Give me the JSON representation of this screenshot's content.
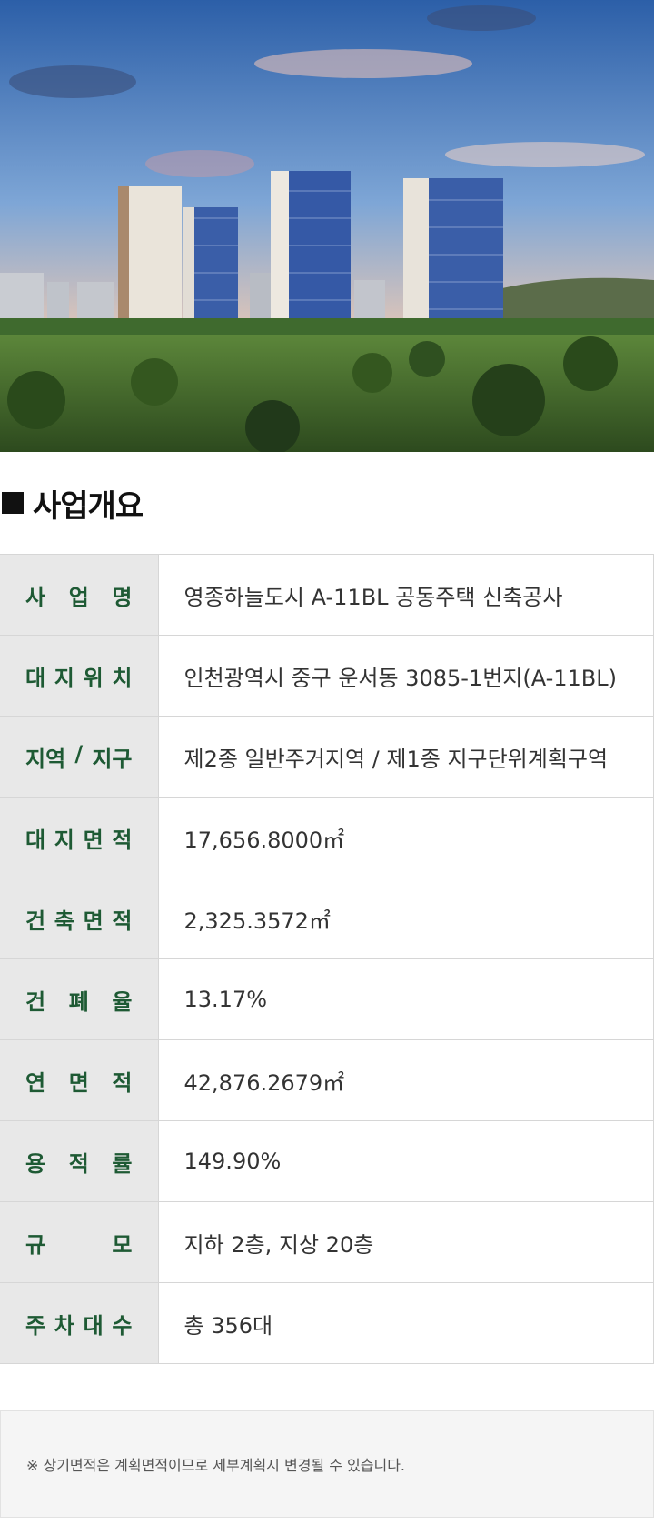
{
  "hero": {
    "image": "apartment-complex-rendering"
  },
  "section": {
    "title": "사업개요"
  },
  "rows": [
    {
      "label": [
        "사",
        "업",
        "명"
      ],
      "value": "영종하늘도시 A-11BL  공동주택 신축공사"
    },
    {
      "label": [
        "대",
        "지",
        "위",
        "치"
      ],
      "value": "인천광역시 중구 운서동 3085-1번지(A-11BL)"
    },
    {
      "label": [
        "지역",
        "/",
        "지구"
      ],
      "value": "제2종 일반주거지역 / 제1종 지구단위계획구역"
    },
    {
      "label": [
        "대",
        "지",
        "면",
        "적"
      ],
      "value": "17,656.8000㎡"
    },
    {
      "label": [
        "건",
        "축",
        "면",
        "적"
      ],
      "value": "2,325.3572㎡"
    },
    {
      "label": [
        "건",
        "폐",
        "율"
      ],
      "value": "13.17%"
    },
    {
      "label": [
        "연",
        "면",
        "적"
      ],
      "value": "42,876.2679㎡"
    },
    {
      "label": [
        "용",
        "적",
        "률"
      ],
      "value": "149.90%"
    },
    {
      "label": [
        "규",
        "모"
      ],
      "value": "지하 2층, 지상 20층"
    },
    {
      "label": [
        "주",
        "차",
        "대",
        "수"
      ],
      "value": "총 356대"
    }
  ],
  "note": "※ 상기면적은 계획면적이므로 세부계획시 변경될 수 있습니다."
}
